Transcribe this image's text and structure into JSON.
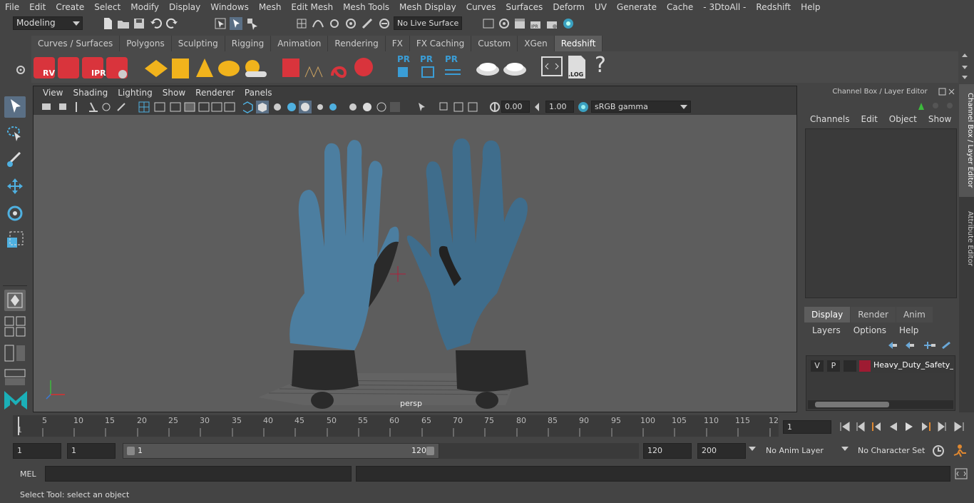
{
  "menubar": [
    "File",
    "Edit",
    "Create",
    "Select",
    "Modify",
    "Display",
    "Windows",
    "Mesh",
    "Edit Mesh",
    "Mesh Tools",
    "Mesh Display",
    "Curves",
    "Surfaces",
    "Deform",
    "UV",
    "Generate",
    "Cache",
    "- 3DtoAll -",
    "Redshift",
    "Help"
  ],
  "status": {
    "mode": "Modeling",
    "live_surface": "No Live Surface"
  },
  "shelf": {
    "tabs": [
      "Curves / Surfaces",
      "Polygons",
      "Sculpting",
      "Rigging",
      "Animation",
      "Rendering",
      "FX",
      "FX Caching",
      "Custom",
      "XGen",
      "Redshift"
    ],
    "active_tab": "Redshift",
    "icon_labels": {
      "rv": "RV",
      "ipr": "IPR",
      "pr": "PR",
      "log": ".LOG",
      "help": "?"
    }
  },
  "viewport": {
    "menu": [
      "View",
      "Shading",
      "Lighting",
      "Show",
      "Renderer",
      "Panels"
    ],
    "exposure": "0.00",
    "gamma": "1.00",
    "color_space": "sRGB gamma",
    "camera_label": "persp"
  },
  "channel_box": {
    "title": "Channel Box / Layer Editor",
    "menu": [
      "Channels",
      "Edit",
      "Object",
      "Show"
    ],
    "layer_tabs": [
      "Display",
      "Render",
      "Anim"
    ],
    "active_layer_tab": "Display",
    "layer_menu": [
      "Layers",
      "Options",
      "Help"
    ],
    "layer": {
      "v": "V",
      "p": "P",
      "name": "Heavy_Duty_Safety_Gloves",
      "color": "#9e1b32"
    }
  },
  "side_tabs": [
    "Channel Box / Layer Editor",
    "Attribute Editor"
  ],
  "timeline": {
    "ticks": [
      "5",
      "10",
      "15",
      "20",
      "25",
      "30",
      "35",
      "40",
      "45",
      "50",
      "55",
      "60",
      "65",
      "70",
      "75",
      "80",
      "85",
      "90",
      "95",
      "100",
      "105",
      "110",
      "115",
      "12"
    ],
    "start_label": "1",
    "current_frame": "1"
  },
  "range": {
    "start": "1",
    "inner_start": "1",
    "slider_start": "1",
    "slider_end": "120",
    "end": "120",
    "outer_end": "200",
    "anim_layer": "No Anim Layer",
    "character_set": "No Character Set"
  },
  "command": {
    "label": "MEL"
  },
  "help_line": "Select Tool: select an object"
}
